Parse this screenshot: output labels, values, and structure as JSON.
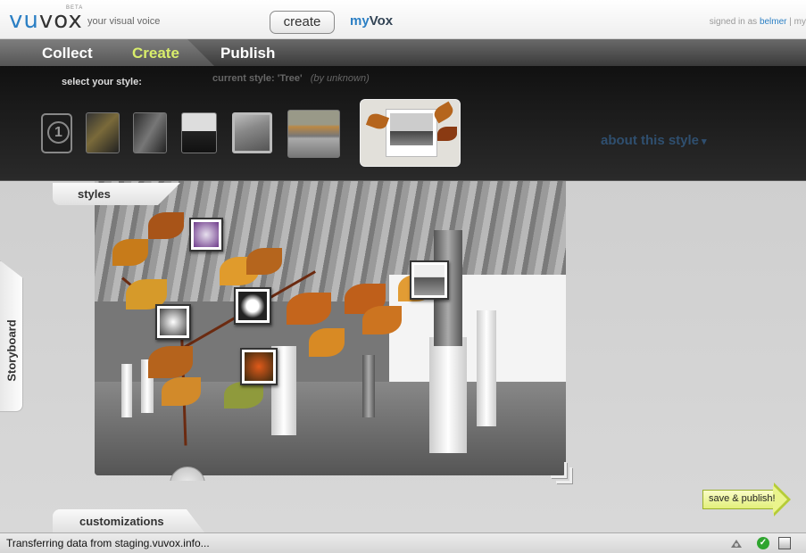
{
  "header": {
    "logo_prefix": "vu",
    "logo_suffix": "vox",
    "beta": "BETA",
    "tagline": "your visual voice",
    "create_button": "create",
    "myvox_prefix": "my",
    "myvox_suffix": "Vox",
    "signed_in_label": "signed in as",
    "username": "belmer",
    "signin_tail": " | my"
  },
  "nav": {
    "tabs": [
      {
        "label": "Collect"
      },
      {
        "label": "Create",
        "active": true
      },
      {
        "label": "Publish"
      }
    ]
  },
  "style_panel": {
    "select_label": "select your style:",
    "current_label": "current style:",
    "current_value": "'Tree'",
    "current_by": "(by unknown)",
    "first_thumb_number": "1",
    "about_link": "about this style",
    "about_chevron": "▾"
  },
  "tabs": {
    "styles": "styles",
    "storyboard": "Storyboard",
    "customizations": "customizations"
  },
  "save_publish": "save & publish!",
  "status": {
    "text": "Transferring data from staging.vuvox.info...",
    "check": "✓"
  },
  "colors": {
    "accent_blue": "#2b7fc4",
    "create_active": "#d9ee6b",
    "save_green": "#e2ef7a"
  }
}
